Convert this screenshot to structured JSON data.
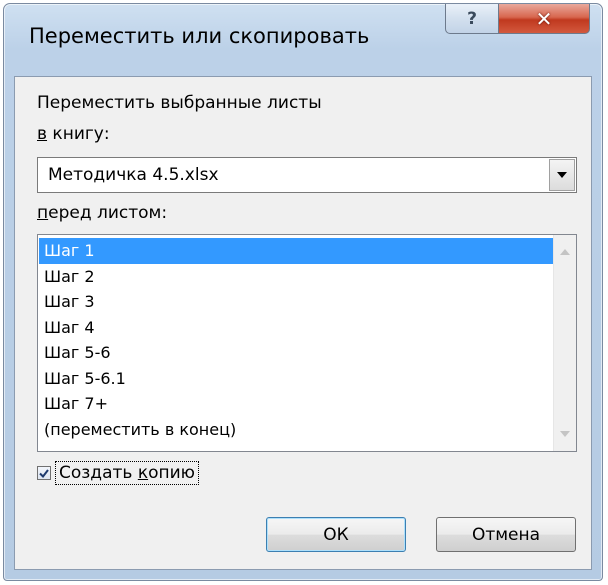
{
  "dialog": {
    "title": "Переместить или скопировать",
    "help_glyph": "?",
    "close_glyph": "✕"
  },
  "content": {
    "move_label": "Переместить выбранные листы",
    "book_label_accel": "в",
    "book_label_rest": " книгу:",
    "book_value": "Методичка 4.5.xlsx",
    "before_label_accel": "п",
    "before_label_rest": "еред листом:",
    "sheets": [
      "Шаг 1",
      "Шаг 2",
      "Шаг 3",
      "Шаг 4",
      "Шаг 5-6",
      "Шаг 5-6.1",
      "Шаг 7+",
      "(переместить в конец)"
    ],
    "selected_index": 0,
    "checkbox_label_pre": "Создать ",
    "checkbox_label_accel": "к",
    "checkbox_label_post": "опию",
    "checkbox_checked": true
  },
  "buttons": {
    "ok": "ОК",
    "cancel": "Отмена"
  },
  "icons": {
    "help": "help-icon",
    "close": "close-icon",
    "dropdown": "chevron-down-icon",
    "scroll_up": "scroll-up-icon",
    "scroll_down": "scroll-down-icon",
    "check": "checkmark-icon"
  },
  "colors": {
    "selection": "#3399ff",
    "close_button": "#c0391f",
    "title_bar": "#bcd1e8"
  }
}
